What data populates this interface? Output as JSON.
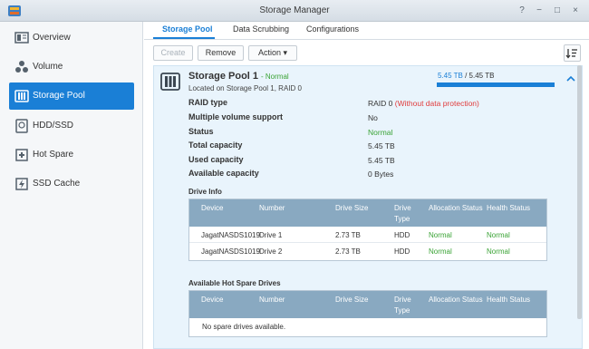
{
  "window": {
    "title": "Storage Manager",
    "controls": {
      "help": "?",
      "minimize": "−",
      "maximize": "□",
      "close": "×"
    }
  },
  "sidebar": {
    "items": [
      {
        "label": "Overview",
        "icon": "overview-icon"
      },
      {
        "label": "Volume",
        "icon": "volume-icon"
      },
      {
        "label": "Storage Pool",
        "icon": "storage-pool-icon",
        "active": true
      },
      {
        "label": "HDD/SSD",
        "icon": "hdd-icon"
      },
      {
        "label": "Hot Spare",
        "icon": "hot-spare-icon"
      },
      {
        "label": "SSD Cache",
        "icon": "ssd-cache-icon"
      }
    ]
  },
  "tabs": [
    {
      "label": "Storage Pool",
      "active": true
    },
    {
      "label": "Data Scrubbing"
    },
    {
      "label": "Configurations"
    }
  ],
  "toolbar": {
    "create": "Create",
    "remove": "Remove",
    "action": "Action"
  },
  "pool": {
    "name": "Storage Pool 1",
    "status": "- Normal",
    "location": "Located on Storage Pool 1, RAID 0",
    "usage": {
      "used": "5.45 TB",
      "separator": " / ",
      "total": "5.45 TB",
      "fraction": 1.0
    },
    "props": [
      {
        "label": "RAID type",
        "value": "RAID 0",
        "note": "(Without data protection)"
      },
      {
        "label": "Multiple volume support",
        "value": "No"
      },
      {
        "label": "Status",
        "value": "Normal"
      },
      {
        "label": "Total capacity",
        "value": "5.45 TB"
      },
      {
        "label": "Used capacity",
        "value": "5.45 TB"
      },
      {
        "label": "Available capacity",
        "value": "0 Bytes"
      }
    ]
  },
  "drive_info": {
    "title": "Drive Info",
    "columns": [
      "Device",
      "Number",
      "Drive Size",
      "Drive Type",
      "Allocation Status",
      "Health Status"
    ],
    "rows": [
      {
        "device": "JagatNASDS1019",
        "number": "Drive 1",
        "size": "2.73 TB",
        "type": "HDD",
        "allocation": "Normal",
        "health": "Normal"
      },
      {
        "device": "JagatNASDS1019",
        "number": "Drive 2",
        "size": "2.73 TB",
        "type": "HDD",
        "allocation": "Normal",
        "health": "Normal"
      }
    ]
  },
  "hot_spare": {
    "title": "Available Hot Spare Drives",
    "columns": [
      "Device",
      "Number",
      "Drive Size",
      "Drive Type",
      "Allocation Status",
      "Health Status"
    ],
    "empty": "No spare drives available."
  }
}
